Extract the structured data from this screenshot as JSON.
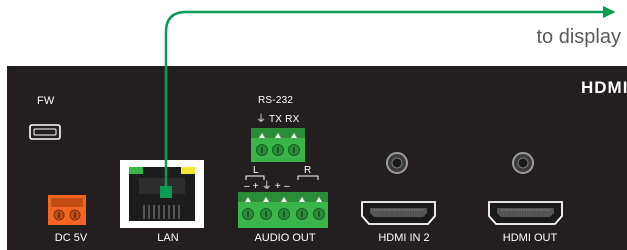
{
  "annotation": {
    "text": "to display",
    "line_color": "#0a9c53"
  },
  "panel": {
    "background": "#231f20",
    "logo": "HDMI",
    "rs232": {
      "title": "RS-232",
      "pins": "⏚  TX  RX"
    },
    "audio_pins": {
      "left_group": "L",
      "right_group": "R",
      "signs": "–  +    ⏚   +  –"
    },
    "ports": [
      {
        "name": "fw",
        "label": "FW",
        "icon": "mini-usb-port-icon"
      },
      {
        "name": "dc",
        "label": "DC 5V",
        "icon": "power-terminal-icon",
        "color": "#f26522"
      },
      {
        "name": "lan",
        "label": "LAN",
        "icon": "rj45-port-icon"
      },
      {
        "name": "audio",
        "label": "AUDIO OUT",
        "icon": "audio-terminal-block-icon",
        "color": "#39b54a"
      },
      {
        "name": "hdmi-in",
        "label": "HDMI IN 2",
        "icon": "hdmi-port-icon"
      },
      {
        "name": "hdmi-out",
        "label": "HDMI OUT",
        "icon": "hdmi-port-icon"
      }
    ]
  }
}
